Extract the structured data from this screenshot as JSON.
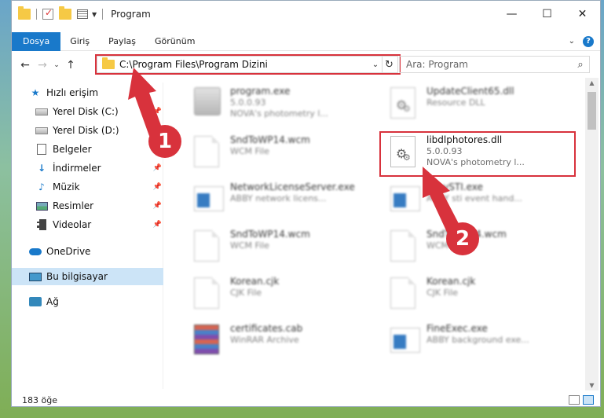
{
  "window": {
    "title": "Program"
  },
  "ribbon": {
    "tabs": [
      "Dosya",
      "Giriş",
      "Paylaş",
      "Görünüm"
    ],
    "help": "?"
  },
  "address": {
    "path": "C:\\Program Files\\Program Dizini"
  },
  "search": {
    "placeholder": "Ara: Program"
  },
  "sidebar": {
    "items": [
      {
        "label": "Hızlı erişim"
      },
      {
        "label": "Yerel Disk (C:)"
      },
      {
        "label": "Yerel Disk (D:)"
      },
      {
        "label": "Belgeler"
      },
      {
        "label": "İndirmeler"
      },
      {
        "label": "Müzik"
      },
      {
        "label": "Resimler"
      },
      {
        "label": "Videolar"
      },
      {
        "label": "OneDrive"
      },
      {
        "label": "Bu bilgisayar"
      },
      {
        "label": "Ağ"
      }
    ]
  },
  "files": [
    {
      "name": "program.exe",
      "line1": "5.0.0.93",
      "line2": "NOVA's photometry l..."
    },
    {
      "name": "UpdateClient65.dll",
      "line1": "Resource DLL",
      "line2": ""
    },
    {
      "name": "SndToWP14.wcm",
      "line1": "WCM File",
      "line2": ""
    },
    {
      "name": "libdlphotores.dll",
      "line1": "5.0.0.93",
      "line2": "NOVA's photometry l..."
    },
    {
      "name": "NetworkLicenseServer.exe",
      "line1": "ABBY network licens...",
      "line2": ""
    },
    {
      "name": "EasySTI.exe",
      "line1": "ABBY sti event hand...",
      "line2": ""
    },
    {
      "name": "SndToWP14.wcm",
      "line1": "WCM File",
      "line2": ""
    },
    {
      "name": "SndToWP14.wcm",
      "line1": "WCM File",
      "line2": ""
    },
    {
      "name": "Korean.cjk",
      "line1": "CJK File",
      "line2": ""
    },
    {
      "name": "Korean.cjk",
      "line1": "CJK File",
      "line2": ""
    },
    {
      "name": "certificates.cab",
      "line1": "WinRAR Archive",
      "line2": ""
    },
    {
      "name": "FineExec.exe",
      "line1": "ABBY background exe...",
      "line2": ""
    }
  ],
  "callouts": {
    "step1": "1",
    "step2": "2"
  },
  "status": {
    "count": "183 öğe"
  },
  "colors": {
    "accent": "#1979ca",
    "highlight": "#d8323c"
  }
}
